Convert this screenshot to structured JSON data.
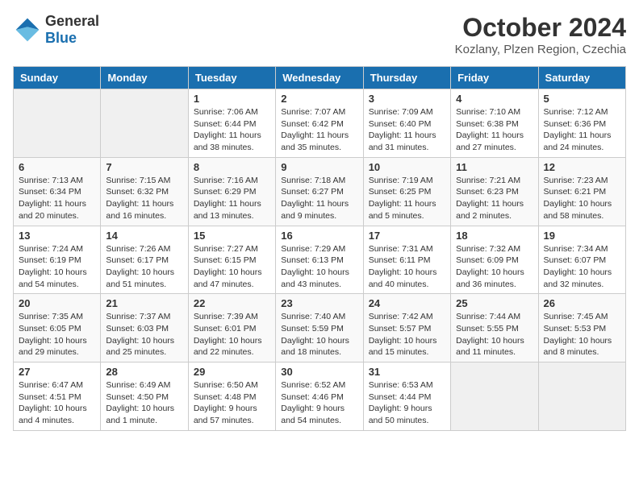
{
  "header": {
    "logo_general": "General",
    "logo_blue": "Blue",
    "month_title": "October 2024",
    "location": "Kozlany, Plzen Region, Czechia"
  },
  "days_of_week": [
    "Sunday",
    "Monday",
    "Tuesday",
    "Wednesday",
    "Thursday",
    "Friday",
    "Saturday"
  ],
  "weeks": [
    [
      {
        "day": "",
        "info": ""
      },
      {
        "day": "",
        "info": ""
      },
      {
        "day": "1",
        "sunrise": "7:06 AM",
        "sunset": "6:44 PM",
        "daylight": "11 hours and 38 minutes."
      },
      {
        "day": "2",
        "sunrise": "7:07 AM",
        "sunset": "6:42 PM",
        "daylight": "11 hours and 35 minutes."
      },
      {
        "day": "3",
        "sunrise": "7:09 AM",
        "sunset": "6:40 PM",
        "daylight": "11 hours and 31 minutes."
      },
      {
        "day": "4",
        "sunrise": "7:10 AM",
        "sunset": "6:38 PM",
        "daylight": "11 hours and 27 minutes."
      },
      {
        "day": "5",
        "sunrise": "7:12 AM",
        "sunset": "6:36 PM",
        "daylight": "11 hours and 24 minutes."
      }
    ],
    [
      {
        "day": "6",
        "sunrise": "7:13 AM",
        "sunset": "6:34 PM",
        "daylight": "11 hours and 20 minutes."
      },
      {
        "day": "7",
        "sunrise": "7:15 AM",
        "sunset": "6:32 PM",
        "daylight": "11 hours and 16 minutes."
      },
      {
        "day": "8",
        "sunrise": "7:16 AM",
        "sunset": "6:29 PM",
        "daylight": "11 hours and 13 minutes."
      },
      {
        "day": "9",
        "sunrise": "7:18 AM",
        "sunset": "6:27 PM",
        "daylight": "11 hours and 9 minutes."
      },
      {
        "day": "10",
        "sunrise": "7:19 AM",
        "sunset": "6:25 PM",
        "daylight": "11 hours and 5 minutes."
      },
      {
        "day": "11",
        "sunrise": "7:21 AM",
        "sunset": "6:23 PM",
        "daylight": "11 hours and 2 minutes."
      },
      {
        "day": "12",
        "sunrise": "7:23 AM",
        "sunset": "6:21 PM",
        "daylight": "10 hours and 58 minutes."
      }
    ],
    [
      {
        "day": "13",
        "sunrise": "7:24 AM",
        "sunset": "6:19 PM",
        "daylight": "10 hours and 54 minutes."
      },
      {
        "day": "14",
        "sunrise": "7:26 AM",
        "sunset": "6:17 PM",
        "daylight": "10 hours and 51 minutes."
      },
      {
        "day": "15",
        "sunrise": "7:27 AM",
        "sunset": "6:15 PM",
        "daylight": "10 hours and 47 minutes."
      },
      {
        "day": "16",
        "sunrise": "7:29 AM",
        "sunset": "6:13 PM",
        "daylight": "10 hours and 43 minutes."
      },
      {
        "day": "17",
        "sunrise": "7:31 AM",
        "sunset": "6:11 PM",
        "daylight": "10 hours and 40 minutes."
      },
      {
        "day": "18",
        "sunrise": "7:32 AM",
        "sunset": "6:09 PM",
        "daylight": "10 hours and 36 minutes."
      },
      {
        "day": "19",
        "sunrise": "7:34 AM",
        "sunset": "6:07 PM",
        "daylight": "10 hours and 32 minutes."
      }
    ],
    [
      {
        "day": "20",
        "sunrise": "7:35 AM",
        "sunset": "6:05 PM",
        "daylight": "10 hours and 29 minutes."
      },
      {
        "day": "21",
        "sunrise": "7:37 AM",
        "sunset": "6:03 PM",
        "daylight": "10 hours and 25 minutes."
      },
      {
        "day": "22",
        "sunrise": "7:39 AM",
        "sunset": "6:01 PM",
        "daylight": "10 hours and 22 minutes."
      },
      {
        "day": "23",
        "sunrise": "7:40 AM",
        "sunset": "5:59 PM",
        "daylight": "10 hours and 18 minutes."
      },
      {
        "day": "24",
        "sunrise": "7:42 AM",
        "sunset": "5:57 PM",
        "daylight": "10 hours and 15 minutes."
      },
      {
        "day": "25",
        "sunrise": "7:44 AM",
        "sunset": "5:55 PM",
        "daylight": "10 hours and 11 minutes."
      },
      {
        "day": "26",
        "sunrise": "7:45 AM",
        "sunset": "5:53 PM",
        "daylight": "10 hours and 8 minutes."
      }
    ],
    [
      {
        "day": "27",
        "sunrise": "6:47 AM",
        "sunset": "4:51 PM",
        "daylight": "10 hours and 4 minutes."
      },
      {
        "day": "28",
        "sunrise": "6:49 AM",
        "sunset": "4:50 PM",
        "daylight": "10 hours and 1 minute."
      },
      {
        "day": "29",
        "sunrise": "6:50 AM",
        "sunset": "4:48 PM",
        "daylight": "9 hours and 57 minutes."
      },
      {
        "day": "30",
        "sunrise": "6:52 AM",
        "sunset": "4:46 PM",
        "daylight": "9 hours and 54 minutes."
      },
      {
        "day": "31",
        "sunrise": "6:53 AM",
        "sunset": "4:44 PM",
        "daylight": "9 hours and 50 minutes."
      },
      {
        "day": "",
        "info": ""
      },
      {
        "day": "",
        "info": ""
      }
    ]
  ],
  "labels": {
    "sunrise": "Sunrise: ",
    "sunset": "Sunset: ",
    "daylight": "Daylight: "
  }
}
